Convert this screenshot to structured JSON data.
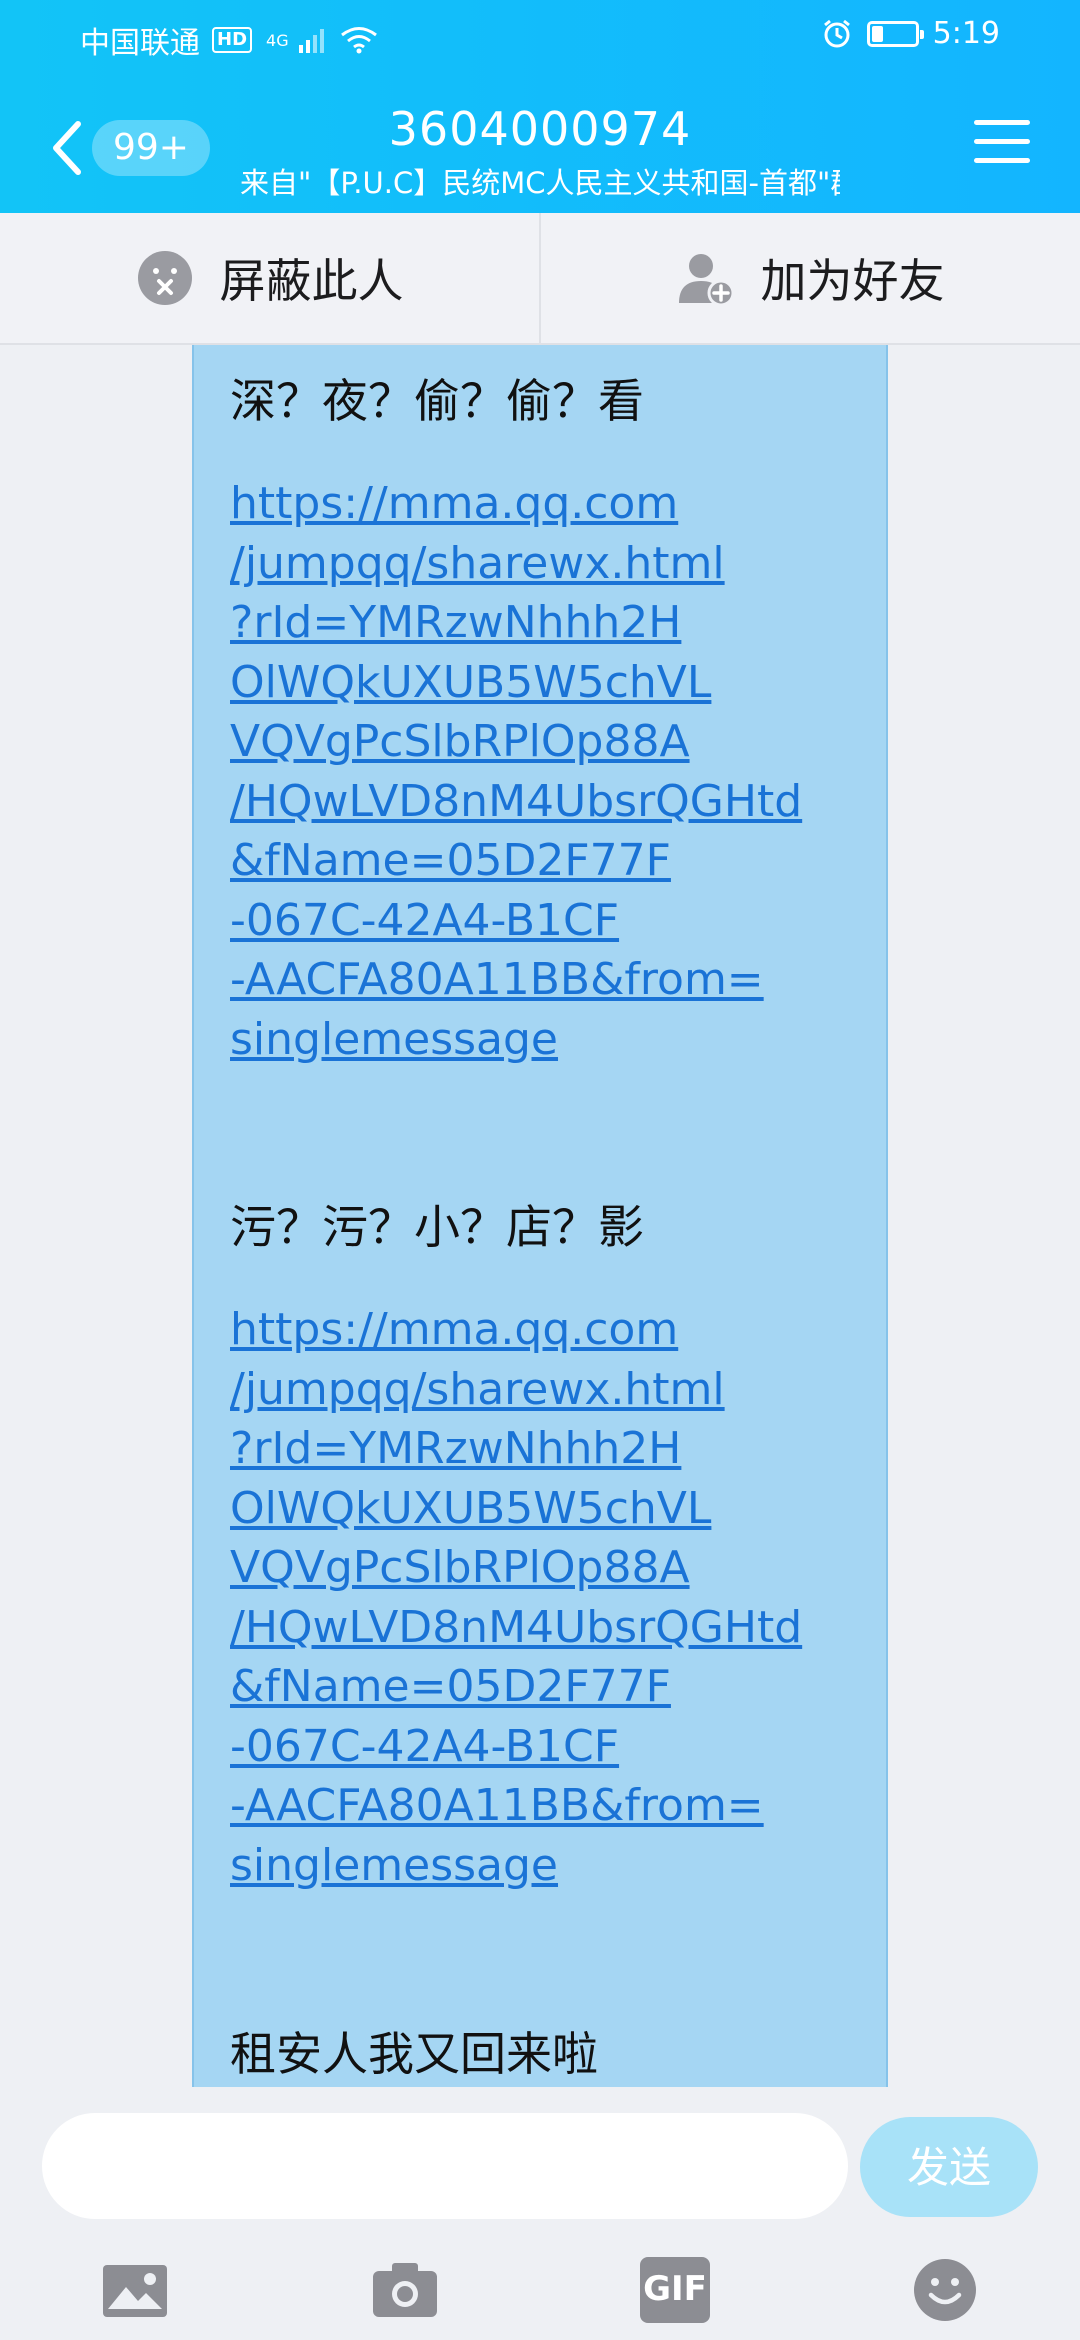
{
  "status_bar": {
    "carrier": "中国联通",
    "hd": "HD",
    "network": "4G",
    "time": "5:19"
  },
  "header": {
    "unread_count": "99+",
    "title": "3604000974",
    "subtitle": "来自\"【P.U.C】民统MC人民主义共和国-首都\"群"
  },
  "actions": {
    "block_label": "屏蔽此人",
    "add_friend_label": "加为好友"
  },
  "message": {
    "line1": "深？夜？偷？偷？看",
    "link1": [
      "https://mma.qq.com",
      "/jumpqq/sharewx.html",
      "?rId=YMRzwNhhh2H",
      "OlWQkUXUB5W5chVL",
      "VQVgPcSlbRPlOp88A",
      "/HQwLVD8nM4UbsrQGHtd",
      "&fName=05D2F77F",
      "-067C-42A4-B1CF",
      "-AACFA80A11BB&from=",
      "singlemessage"
    ],
    "line2": "污？污？小？店？影",
    "link2": [
      "https://mma.qq.com",
      "/jumpqq/sharewx.html",
      "?rId=YMRzwNhhh2H",
      "OlWQkUXUB5W5chVL",
      "VQVgPcSlbRPlOp88A",
      "/HQwLVD8nM4UbsrQGHtd",
      "&fName=05D2F77F",
      "-067C-42A4-B1CF",
      "-AACFA80A11BB&from=",
      "singlemessage"
    ],
    "line3": "租安人我又回来啦"
  },
  "input": {
    "value": "",
    "send_label": "发送"
  },
  "toolbar": {
    "gif_label": "GIF"
  },
  "colors": {
    "header": "#13b5ff",
    "bubble": "#a5d6f3",
    "link": "#1a73d6",
    "send": "#a8e2f8"
  }
}
